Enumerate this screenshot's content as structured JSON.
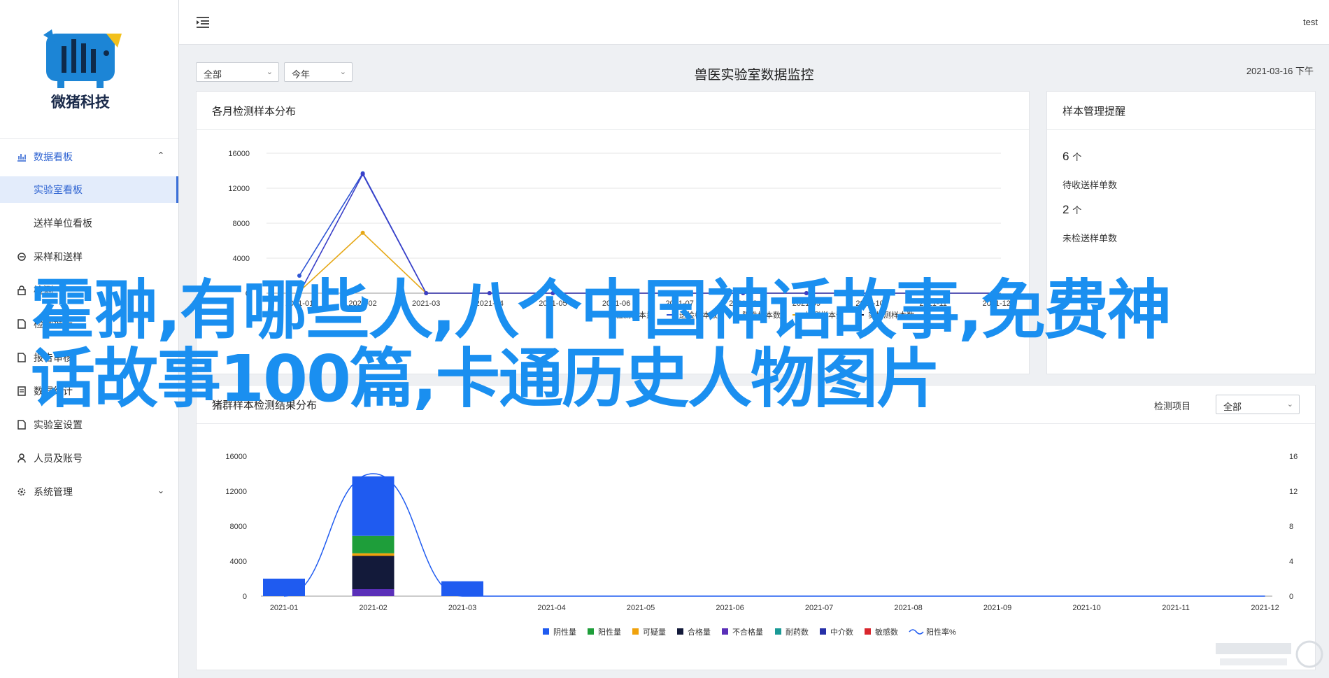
{
  "sidebar": {
    "logo_text": "微猪科技",
    "items": [
      {
        "label": "数据看板",
        "icon": "chart-icon",
        "expanded": true
      },
      {
        "label": "实验室看板",
        "sub": true,
        "active": true
      },
      {
        "label": "送样单位看板",
        "sub": true
      },
      {
        "label": "采样和送样",
        "icon": "flask-icon"
      },
      {
        "label": "检测",
        "icon": "lock-icon"
      },
      {
        "label": "检测报告",
        "icon": "report-icon"
      },
      {
        "label": "报告审核",
        "icon": "doc-icon"
      },
      {
        "label": "数据统计",
        "icon": "list-icon"
      },
      {
        "label": "实验室设置",
        "icon": "doc-icon"
      },
      {
        "label": "人员及账号",
        "icon": "user-icon"
      },
      {
        "label": "系统管理",
        "icon": "gear-icon",
        "collapsed": true
      }
    ]
  },
  "topbar": {
    "user": "test"
  },
  "filters": {
    "scope": "全部",
    "period": "今年"
  },
  "page": {
    "title": "兽医实验室数据监控",
    "date": "2021-03-16 下午"
  },
  "monthly_card": {
    "title": "各月检测样本分布",
    "legend": [
      "送检样本数",
      "阳性样本数",
      "检测样本数",
      "实检测样本数"
    ],
    "legend_prefix": "只检测样本量",
    "legend_colors": [
      "#2f55d4",
      "#1e9e4a",
      "#e6a817",
      "#1b1f3b"
    ]
  },
  "alert_card": {
    "title": "样本管理提醒",
    "stats": [
      {
        "value": "6",
        "unit": "个",
        "label": "待收送样单数"
      },
      {
        "value": "2",
        "unit": "个",
        "label": "未检送样单数"
      }
    ]
  },
  "result_card": {
    "title": "猪群样本检测结果分布",
    "filter_label": "检测项目",
    "filter_value": "全部",
    "legend": [
      {
        "name": "阴性量",
        "color": "#1f5bf0"
      },
      {
        "name": "阳性量",
        "color": "#1e9e3a"
      },
      {
        "name": "可疑量",
        "color": "#f0a20c"
      },
      {
        "name": "合格量",
        "color": "#131a3a"
      },
      {
        "name": "不合格量",
        "color": "#5a2fb8"
      },
      {
        "name": "耐药数",
        "color": "#1a9a96"
      },
      {
        "name": "中介数",
        "color": "#262fa8"
      },
      {
        "name": "敏感数",
        "color": "#d9262d"
      },
      {
        "name": "阳性率%",
        "color": "#1f5bf0",
        "line": true
      }
    ]
  },
  "overlay_text": "霍翀,有哪些人,八个中国神话故事,免费神话故事100篇,卡通历史人物图片",
  "chart_data": [
    {
      "type": "line",
      "title": "各月检测样本分布",
      "x": [
        "2021-01",
        "2021-02",
        "2021-03",
        "2021-04",
        "2021-05",
        "2021-06",
        "2021-07",
        "2021-08",
        "2021-09",
        "2021-10",
        "2021-11",
        "2021-12"
      ],
      "x_ticks": [
        "2021-01",
        "2021-02",
        "2021-03",
        "2021-04",
        "2021-05",
        "2021-06",
        "2021-07",
        "2021-08",
        "2021-09",
        "2021-10",
        "2021-11",
        "2021-12"
      ],
      "ylim": [
        0,
        16000
      ],
      "yticks": [
        0,
        4000,
        8000,
        12000,
        16000
      ],
      "series": [
        {
          "name": "送检样本数",
          "color": "#2f55d4",
          "values": [
            2000,
            13700,
            0,
            0,
            0,
            0,
            0,
            0,
            0,
            0,
            0,
            0
          ]
        },
        {
          "name": "阳性样本数",
          "color": "#e6a817",
          "values": [
            200,
            6900,
            0,
            0,
            0,
            0,
            0,
            0,
            0,
            0,
            0,
            0
          ]
        },
        {
          "name": "检测样本数",
          "color": "#3a3fc8",
          "values": [
            0,
            13600,
            0,
            0,
            0,
            0,
            0,
            0,
            0,
            0,
            0,
            0
          ]
        }
      ]
    },
    {
      "type": "bar",
      "title": "猪群样本检测结果分布",
      "categories": [
        "2021-01",
        "2021-02",
        "2021-03",
        "2021-04",
        "2021-05",
        "2021-06",
        "2021-07",
        "2021-08",
        "2021-09",
        "2021-10",
        "2021-11",
        "2021-12"
      ],
      "ylim": [
        0,
        16000
      ],
      "yticks": [
        0,
        4000,
        8000,
        12000,
        16000
      ],
      "y2lim": [
        0,
        16
      ],
      "y2ticks": [
        0,
        4,
        8,
        12,
        16
      ],
      "stacked": true,
      "series": [
        {
          "name": "不合格量",
          "color": "#5a2fb8",
          "values": [
            0,
            800,
            0,
            0,
            0,
            0,
            0,
            0,
            0,
            0,
            0,
            0
          ]
        },
        {
          "name": "合格量",
          "color": "#131a3a",
          "values": [
            0,
            3800,
            0,
            0,
            0,
            0,
            0,
            0,
            0,
            0,
            0,
            0
          ]
        },
        {
          "name": "可疑量",
          "color": "#f0a20c",
          "values": [
            0,
            300,
            0,
            0,
            0,
            0,
            0,
            0,
            0,
            0,
            0,
            0
          ]
        },
        {
          "name": "阳性量",
          "color": "#1e9e3a",
          "values": [
            0,
            2000,
            0,
            0,
            0,
            0,
            0,
            0,
            0,
            0,
            0,
            0
          ]
        },
        {
          "name": "阴性量",
          "color": "#1f5bf0",
          "values": [
            2000,
            6800,
            1700,
            0,
            0,
            0,
            0,
            0,
            0,
            0,
            0,
            0
          ]
        }
      ],
      "line": {
        "name": "阳性率%",
        "color": "#1f5bf0",
        "values": [
          0,
          14,
          0,
          0,
          0,
          0,
          0,
          0,
          0,
          0,
          0,
          0
        ]
      }
    }
  ]
}
